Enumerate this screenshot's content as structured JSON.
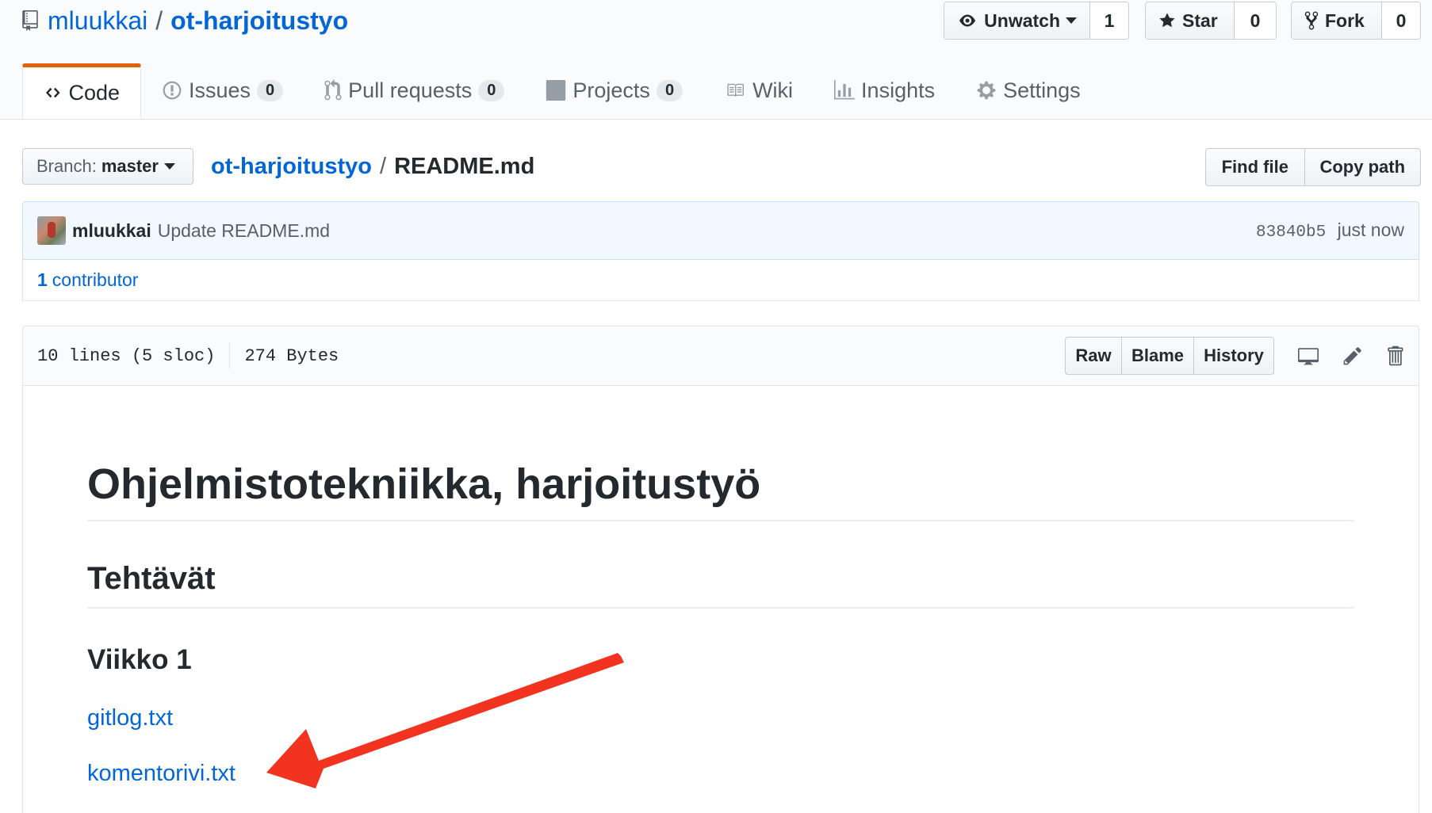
{
  "repo": {
    "owner": "mluukkai",
    "separator": "/",
    "name": "ot-harjoitustyo"
  },
  "social": {
    "watch_label": "Unwatch",
    "watch_count": "1",
    "star_label": "Star",
    "star_count": "0",
    "fork_label": "Fork",
    "fork_count": "0"
  },
  "tabs": [
    {
      "label": "Code"
    },
    {
      "label": "Issues",
      "count": "0"
    },
    {
      "label": "Pull requests",
      "count": "0"
    },
    {
      "label": "Projects",
      "count": "0"
    },
    {
      "label": "Wiki"
    },
    {
      "label": "Insights"
    },
    {
      "label": "Settings"
    }
  ],
  "branch": {
    "label": "Branch:",
    "value": "master"
  },
  "breadcrumb": {
    "root": "ot-harjoitustyo",
    "separator": "/",
    "file": "README.md"
  },
  "file_nav": {
    "find_file": "Find file",
    "copy_path": "Copy path"
  },
  "commit": {
    "author": "mluukkai",
    "message": "Update README.md",
    "sha": "83840b5",
    "time": "just now"
  },
  "contributors": {
    "count": "1",
    "label": "contributor"
  },
  "file_header": {
    "lines": "10 lines (5 sloc)",
    "size": "274 Bytes",
    "raw": "Raw",
    "blame": "Blame",
    "history": "History"
  },
  "readme": {
    "h1": "Ohjelmistotekniikka, harjoitustyö",
    "h2": "Tehtävät",
    "h3": "Viikko 1",
    "links": [
      "gitlog.txt",
      "komentorivi.txt"
    ]
  },
  "colors": {
    "link": "#0366d6",
    "tab_accent": "#e36209",
    "arrow": "#f2331f"
  }
}
